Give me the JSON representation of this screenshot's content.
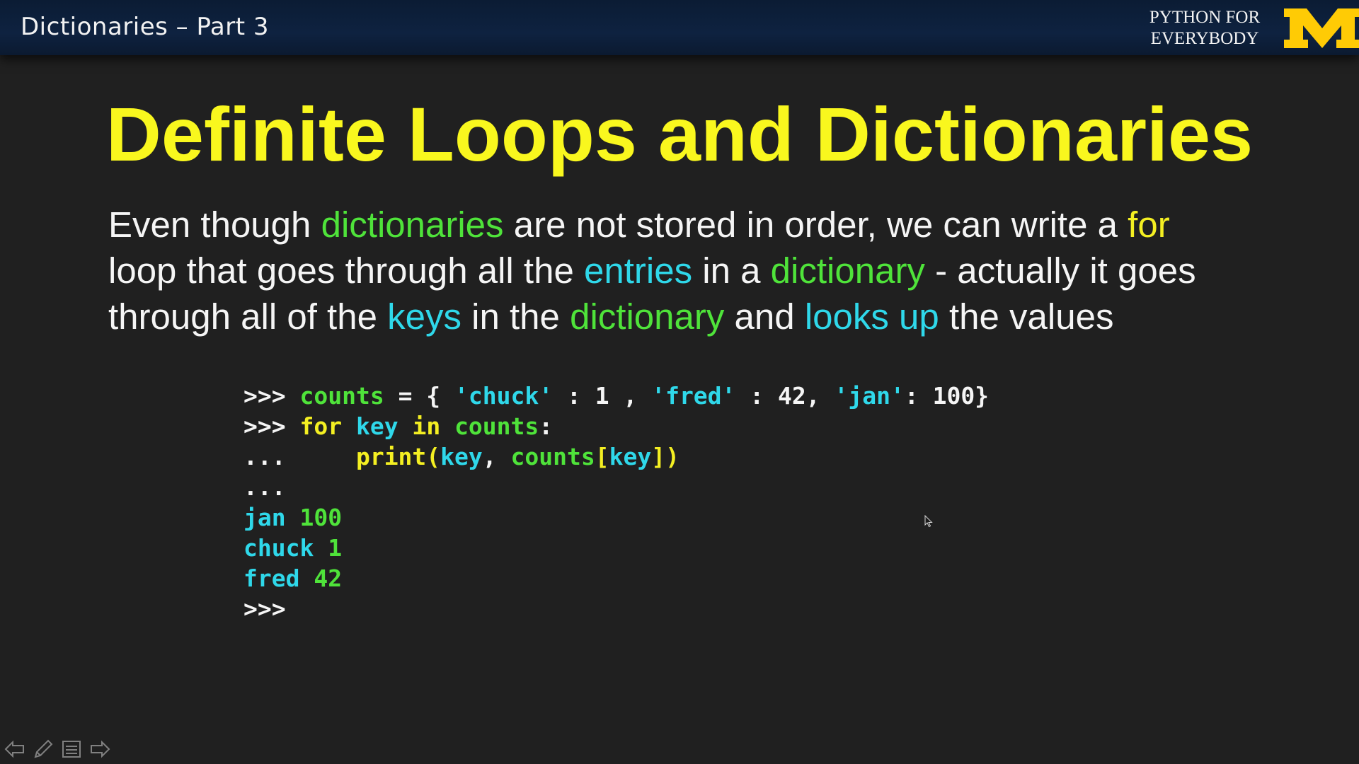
{
  "video": {
    "title": "Dictionaries – Part 3",
    "brand_line1": "PYTHON FOR",
    "brand_line2": "EVERYBODY",
    "logo_text": "M"
  },
  "slide": {
    "title": "Definite Loops and Dictionaries",
    "paragraph": [
      [
        {
          "t": "Even though ",
          "c": "w"
        },
        {
          "t": "dictionaries",
          "c": "g"
        },
        {
          "t": " are not stored in order, we can write a ",
          "c": "w"
        },
        {
          "t": "for",
          "c": "y"
        }
      ],
      [
        {
          "t": "loop that goes through all the ",
          "c": "w"
        },
        {
          "t": "entries",
          "c": "c"
        },
        {
          "t": " in a ",
          "c": "w"
        },
        {
          "t": "dictionary",
          "c": "g"
        },
        {
          "t": " - actually it goes",
          "c": "w"
        }
      ],
      [
        {
          "t": "through all of the ",
          "c": "w"
        },
        {
          "t": "keys",
          "c": "c"
        },
        {
          "t": " in the ",
          "c": "w"
        },
        {
          "t": "dictionary",
          "c": "g"
        },
        {
          "t": " and ",
          "c": "w"
        },
        {
          "t": "looks up",
          "c": "c"
        },
        {
          "t": " the values",
          "c": "w"
        }
      ]
    ],
    "code": [
      [
        {
          "t": ">>> ",
          "c": "w"
        },
        {
          "t": "counts",
          "c": "g"
        },
        {
          "t": " = { ",
          "c": "w"
        },
        {
          "t": "'chuck'",
          "c": "c"
        },
        {
          "t": " : 1 , ",
          "c": "w"
        },
        {
          "t": "'fred'",
          "c": "c"
        },
        {
          "t": " : 42, ",
          "c": "w"
        },
        {
          "t": "'jan'",
          "c": "c"
        },
        {
          "t": ": 100}",
          "c": "w"
        }
      ],
      [
        {
          "t": ">>> ",
          "c": "w"
        },
        {
          "t": "for ",
          "c": "y"
        },
        {
          "t": "key ",
          "c": "c"
        },
        {
          "t": "in ",
          "c": "y"
        },
        {
          "t": "counts",
          "c": "g"
        },
        {
          "t": ":",
          "c": "w"
        }
      ],
      [
        {
          "t": "...     ",
          "c": "w"
        },
        {
          "t": "print(",
          "c": "y"
        },
        {
          "t": "key",
          "c": "c"
        },
        {
          "t": ", ",
          "c": "w"
        },
        {
          "t": "counts",
          "c": "g"
        },
        {
          "t": "[",
          "c": "y"
        },
        {
          "t": "key",
          "c": "c"
        },
        {
          "t": "])",
          "c": "y"
        }
      ],
      [
        {
          "t": "...",
          "c": "w"
        }
      ],
      [
        {
          "t": "jan ",
          "c": "c"
        },
        {
          "t": "100",
          "c": "g"
        }
      ],
      [
        {
          "t": "chuck ",
          "c": "c"
        },
        {
          "t": "1",
          "c": "g"
        }
      ],
      [
        {
          "t": "fred ",
          "c": "c"
        },
        {
          "t": "42",
          "c": "g"
        }
      ],
      [
        {
          "t": ">>>",
          "c": "w"
        }
      ]
    ]
  },
  "controls": {
    "icons": [
      "previous-slide-icon",
      "pen-icon",
      "slide-menu-icon",
      "next-slide-icon"
    ]
  },
  "colors": {
    "title_yellow": "#f9f71e",
    "green": "#4fe33a",
    "cyan": "#2fd8ea",
    "yellow": "#f4ef22",
    "background": "#202020",
    "header": "#0e2240",
    "maize": "#ffcb05"
  }
}
